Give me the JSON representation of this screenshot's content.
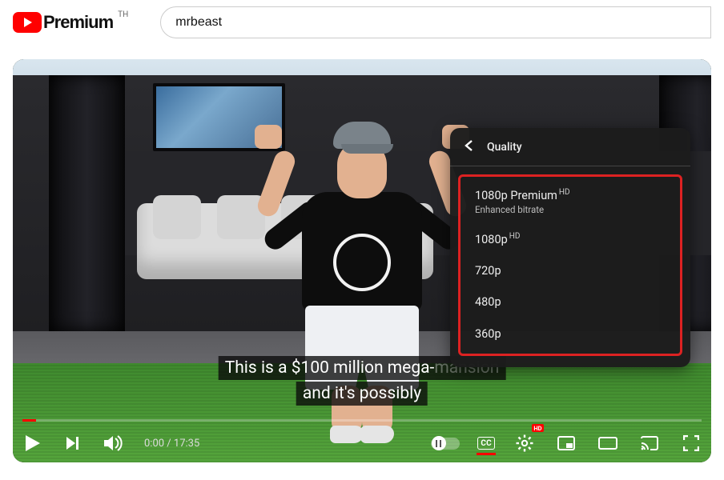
{
  "header": {
    "logo_text": "Premium",
    "country": "TH",
    "search_value": "mrbeast"
  },
  "captions": {
    "line1": "This is a $100 million mega-",
    "line1_ghost": "mansion",
    "line2": "and it's possibly"
  },
  "quality_menu": {
    "title": "Quality",
    "items": [
      {
        "label": "1080p Premium",
        "badge": "HD",
        "sub": "Enhanced bitrate"
      },
      {
        "label": "1080p",
        "badge": "HD"
      },
      {
        "label": "720p"
      },
      {
        "label": "480p"
      },
      {
        "label": "360p"
      }
    ]
  },
  "controls": {
    "time_current": "0:00",
    "time_sep": " / ",
    "time_total": "17:35",
    "cc_label": "CC",
    "hd_badge": "HD"
  }
}
